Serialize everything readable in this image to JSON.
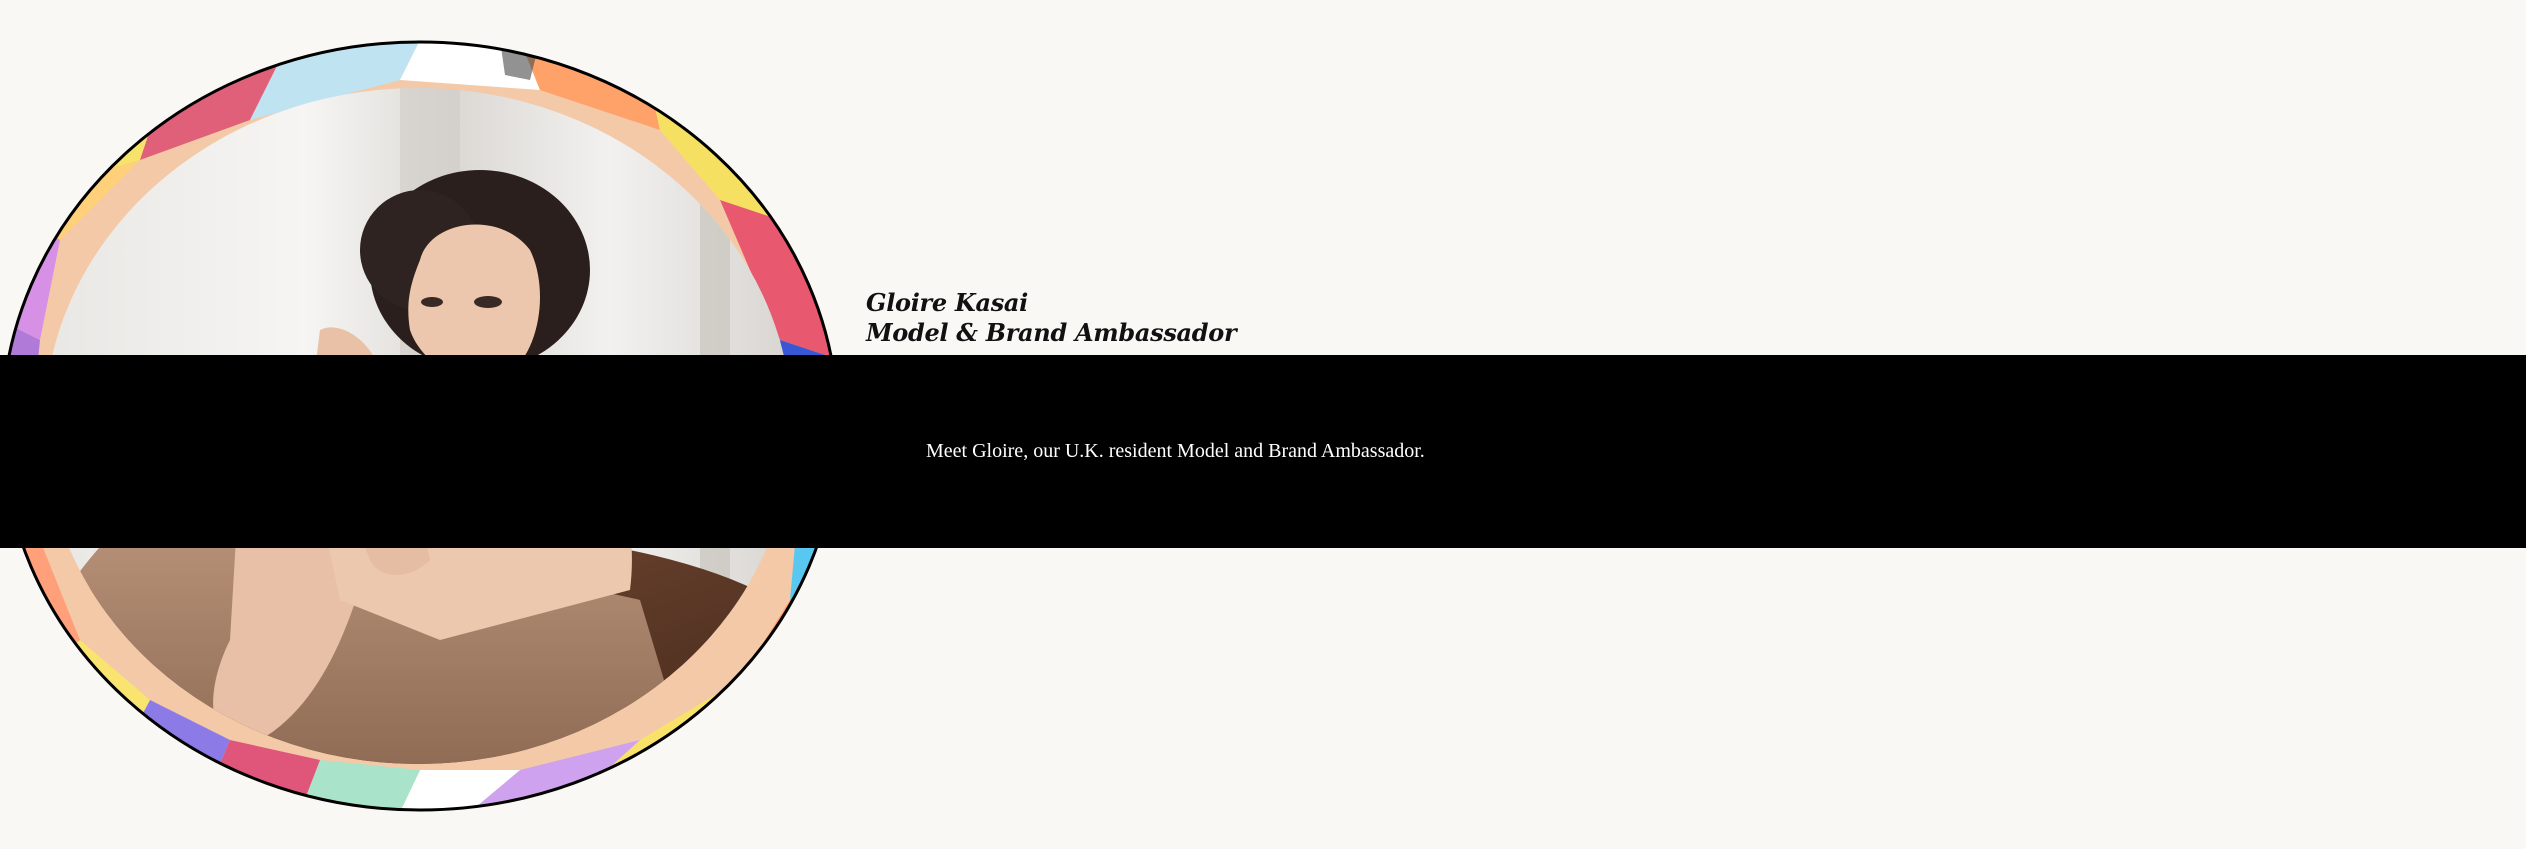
{
  "profile": {
    "name": "Gloire Kasai",
    "role": "Model & Brand Ambassador",
    "blurb": "Meet Gloire, our U.K. resident Model and Brand Ambassador."
  },
  "portrait": {
    "icon": "person-portrait-icon"
  },
  "colors": {
    "page_background": "#faf8f5",
    "band": "#000000",
    "band_text": "#ffffff",
    "heading_text": "#111111",
    "frame_stroke": "#000000"
  }
}
